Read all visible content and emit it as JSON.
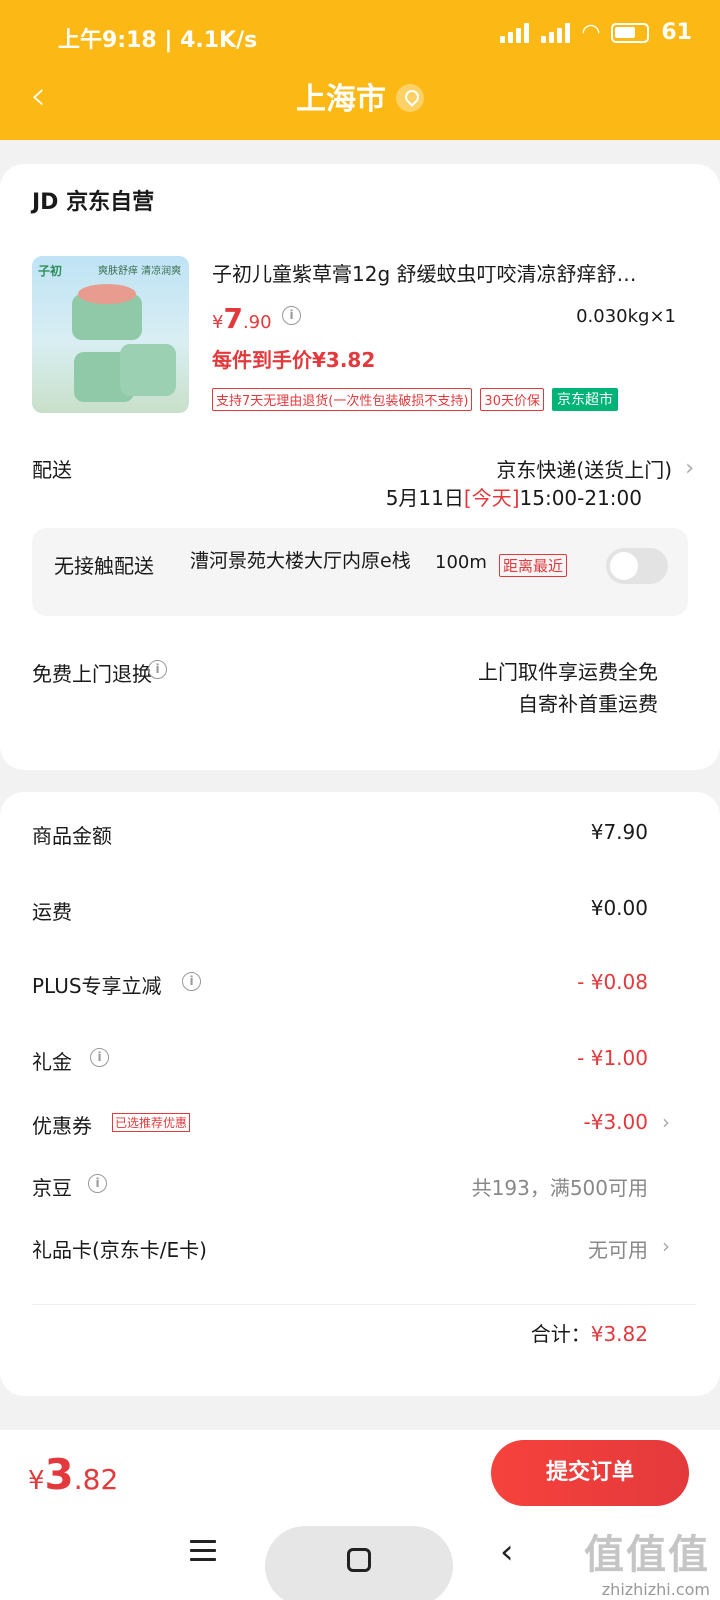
{
  "status_bar": {
    "time_speed": "上午9:18 | 4.1K/s",
    "battery": "61"
  },
  "header": {
    "title": "上海市",
    "icons": {
      "back": "chevron-left-icon",
      "location": "location-pin-icon"
    }
  },
  "order": {
    "shop_name": "JD 京东自营",
    "product": {
      "title": "子初儿童紫草膏12g 舒缓蚊虫叮咬清凉舒痒舒…",
      "image_brand": "子初",
      "image_promo": "爽肤舒痒 清凉润爽",
      "price_symbol": "¥",
      "price_int": "7",
      "price_dec": ".90",
      "weight_qty": "0.030kg×1",
      "each_price": "每件到手价¥3.82",
      "tags": [
        "支持7天无理由退货(一次性包装破损不支持)",
        "30天价保"
      ],
      "tag_green": "京东超市"
    },
    "delivery": {
      "label": "配送",
      "service": "京东快递(送货上门)",
      "date": "5月11日",
      "today": "[今天]",
      "time_range": "15:00-21:00"
    },
    "no_contact": {
      "label": "无接触配送",
      "address": "漕河景苑大楼大厅内原e栈",
      "distance": "100m",
      "badge": "距离最近",
      "enabled": false
    },
    "returns": {
      "label": "免费上门退换",
      "line1": "上门取件享运费全免",
      "line2": "自寄补首重运费"
    }
  },
  "fees": {
    "goods_amount": {
      "label": "商品金额",
      "value": "¥7.90"
    },
    "shipping": {
      "label": "运费",
      "value": "¥0.00"
    },
    "plus": {
      "label": "PLUS专享立减",
      "value": "- ¥0.08"
    },
    "gift_money": {
      "label": "礼金",
      "value": "- ¥1.00"
    },
    "coupon": {
      "label": "优惠券",
      "tag": "已选推荐优惠",
      "value": "-¥3.00"
    },
    "jingdou": {
      "label": "京豆",
      "value": "共193，满500可用"
    },
    "gift_card": {
      "label": "礼品卡(京东卡/E卡)",
      "value": "无可用"
    },
    "total_label": "合计：",
    "total_value": "¥3.82"
  },
  "bottom": {
    "price_symbol": "¥",
    "price_int": "3",
    "price_dec": ".82",
    "submit_label": "提交订单",
    "watermark": "值值值",
    "watermark_url": "zhizhizhi.com"
  },
  "colors": {
    "header_bg": "#fcb915",
    "accent_red": "#e4393c",
    "green_tag": "#00b377"
  }
}
